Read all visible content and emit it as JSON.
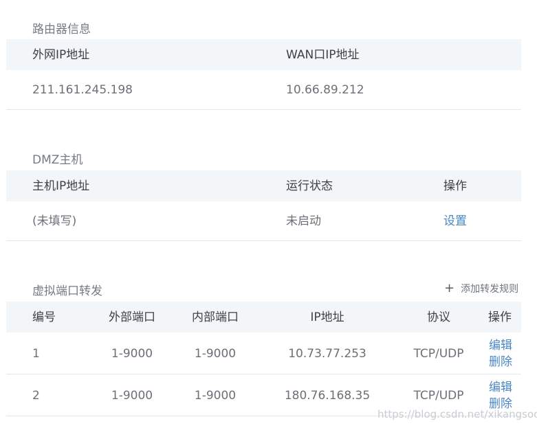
{
  "router_info": {
    "title": "路由器信息",
    "headers": [
      "外网IP地址",
      "WAN口IP地址"
    ],
    "row": [
      "211.161.245.198",
      "10.66.89.212"
    ]
  },
  "dmz": {
    "title": "DMZ主机",
    "headers": [
      "主机IP地址",
      "运行状态",
      "操作"
    ],
    "row": {
      "ip": "(未填写)",
      "status": "未启动",
      "action": "设置"
    }
  },
  "port_forward": {
    "title": "虚拟端口转发",
    "add_label": "添加转发规则",
    "headers": [
      "编号",
      "外部端口",
      "内部端口",
      "IP地址",
      "协议",
      "操作"
    ],
    "rows": [
      {
        "no": "1",
        "ext": "1-9000",
        "int": "1-9000",
        "ip": "10.73.77.253",
        "proto": "TCP/UDP",
        "edit": "编辑",
        "del": "删除"
      },
      {
        "no": "2",
        "ext": "1-9000",
        "int": "1-9000",
        "ip": "180.76.168.35",
        "proto": "TCP/UDP",
        "edit": "编辑",
        "del": "删除"
      }
    ]
  },
  "watermark": "https://blog.csdn.net/xikangsoon"
}
